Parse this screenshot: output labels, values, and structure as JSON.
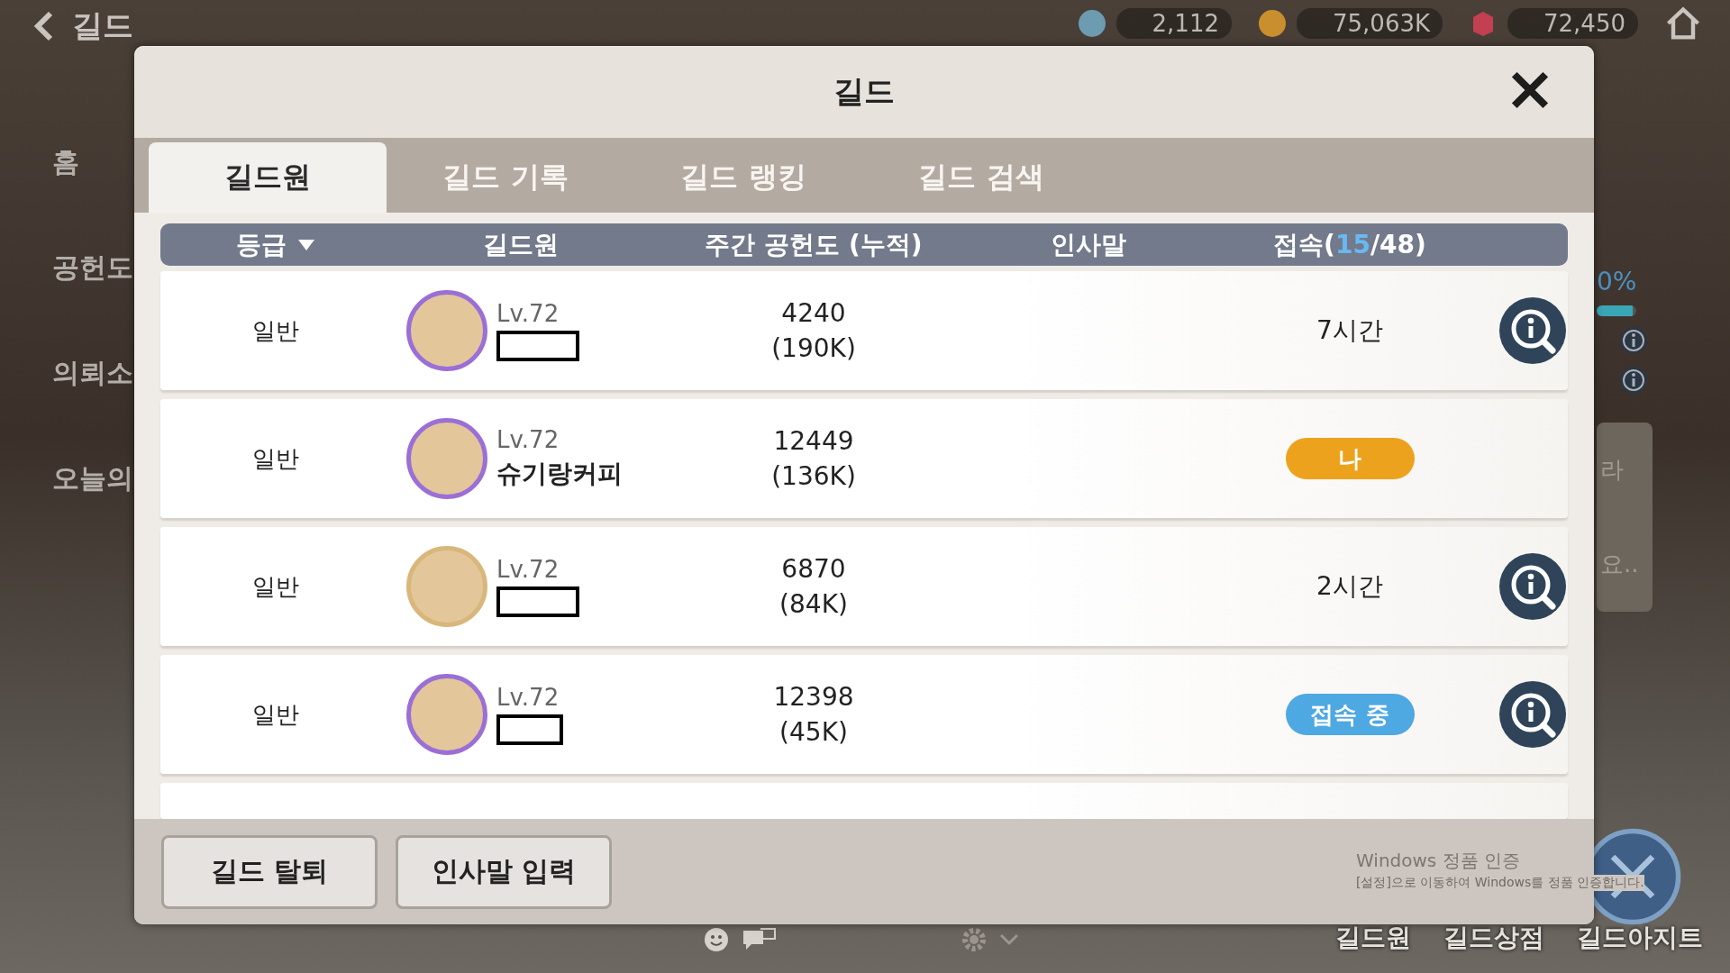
{
  "hud": {
    "title": "길드",
    "currencies": [
      "2,112",
      "75,063K",
      "72,450"
    ]
  },
  "side_menu": [
    "홈",
    "공헌도",
    "의뢰소",
    "오늘의"
  ],
  "side_panel": {
    "percent": "0%",
    "level": 0.9,
    "texts": [
      "라",
      "요.."
    ]
  },
  "bottom_menu": [
    "길드원",
    "길드상점",
    "길드아지트"
  ],
  "os_notice": {
    "title": "Windows 정품 인증",
    "body": "[설정]으로 이동하여 Windows를 정품 인증합니다."
  },
  "dialog": {
    "title": "길드",
    "tabs": [
      {
        "label": "길드원",
        "selected": true
      },
      {
        "label": "길드 기록",
        "selected": false
      },
      {
        "label": "길드 랭킹",
        "selected": false
      },
      {
        "label": "길드 검색",
        "selected": false
      }
    ],
    "columns": [
      {
        "label": "등급",
        "sorted": true
      },
      {
        "label": "길드원",
        "sorted": false
      },
      {
        "label": "주간 공헌도 (누적)",
        "sorted": false
      },
      {
        "label": "인사말",
        "sorted": false
      },
      {
        "prefix": "접속(",
        "highlight": "15",
        "suffix": "/48)",
        "sorted": false
      }
    ],
    "rows": [
      {
        "grade": "일반",
        "level_text": "Lv.72",
        "name": null,
        "color": "#9b6fd6",
        "weekly": "4240",
        "total": "(190K)",
        "status": {
          "kind": "time",
          "text": "7시간"
        },
        "info_button": true
      },
      {
        "grade": "일반",
        "level_text": "Lv.72",
        "name": "슈기랑커피",
        "color": "#9b6fd6",
        "weekly": "12449",
        "total": "(136K)",
        "status": {
          "kind": "me",
          "text": "나"
        },
        "info_button": false
      },
      {
        "grade": "일반",
        "level_text": "Lv.72",
        "name": null,
        "color": "#d9b77a",
        "weekly": "6870",
        "total": "(84K)",
        "status": {
          "kind": "time",
          "text": "2시간"
        },
        "info_button": true
      },
      {
        "grade": "일반",
        "level_text": "Lv.72",
        "name": null,
        "color": "#9b6fd6",
        "weekly": "12398",
        "total": "(45K)",
        "status": {
          "kind": "online",
          "text": "접속 중"
        },
        "info_button": true
      }
    ],
    "buttons": [
      "길드 탈퇴",
      "인사말 입력"
    ]
  }
}
